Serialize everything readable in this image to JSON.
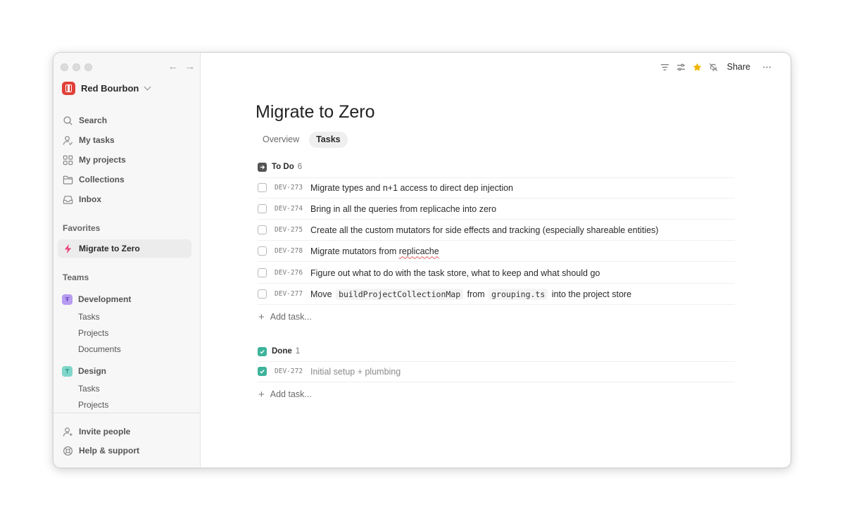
{
  "sidebar": {
    "workspace_name": "Red Bourbon",
    "nav": [
      {
        "label": "Search",
        "icon": "search-icon"
      },
      {
        "label": "My tasks",
        "icon": "user-check-icon"
      },
      {
        "label": "My projects",
        "icon": "grid-icon"
      },
      {
        "label": "Collections",
        "icon": "folder-icon"
      },
      {
        "label": "Inbox",
        "icon": "inbox-icon"
      }
    ],
    "favorites_label": "Favorites",
    "favorite_item": {
      "label": "Migrate to Zero",
      "icon": "bolt-icon"
    },
    "teams_label": "Teams",
    "teams": [
      {
        "name": "Development",
        "color": "#9c7be0",
        "items": [
          "Tasks",
          "Projects",
          "Documents"
        ]
      },
      {
        "name": "Design",
        "color": "#4dbfb0",
        "items": [
          "Tasks",
          "Projects"
        ]
      }
    ],
    "footer": [
      {
        "label": "Invite people",
        "icon": "invite-user-icon"
      },
      {
        "label": "Help & support",
        "icon": "help-lifebuoy-icon"
      }
    ]
  },
  "toolbar": {
    "share_label": "Share",
    "star_color": "#f0b400"
  },
  "main": {
    "title": "Migrate to Zero",
    "tabs": [
      {
        "label": "Overview",
        "active": false
      },
      {
        "label": "Tasks",
        "active": true
      }
    ],
    "groups": [
      {
        "label": "To Do",
        "count": "6",
        "tasks": [
          {
            "id": "DEV-273",
            "title": "Migrate types and n+1 access to direct dep injection"
          },
          {
            "id": "DEV-274",
            "title": "Bring in all the queries from replicache into zero"
          },
          {
            "id": "DEV-275",
            "title": "Create all the custom mutators for side effects and tracking (especially shareable entities)"
          },
          {
            "id": "DEV-278",
            "title_prefix": "Migrate mutators from ",
            "title_underlined": "replicache"
          },
          {
            "id": "DEV-276",
            "title": "Figure out what to do with the task store, what to keep and what should go"
          },
          {
            "id": "DEV-277",
            "title_parts": [
              "Move",
              "buildProjectCollectionMap",
              "from",
              "grouping.ts",
              "into the project store"
            ]
          }
        ],
        "add_label": "Add task..."
      },
      {
        "label": "Done",
        "count": "1",
        "done_color": "#3db39b",
        "tasks": [
          {
            "id": "DEV-272",
            "title": "Initial setup + plumbing"
          }
        ],
        "add_label": "Add task..."
      }
    ]
  }
}
